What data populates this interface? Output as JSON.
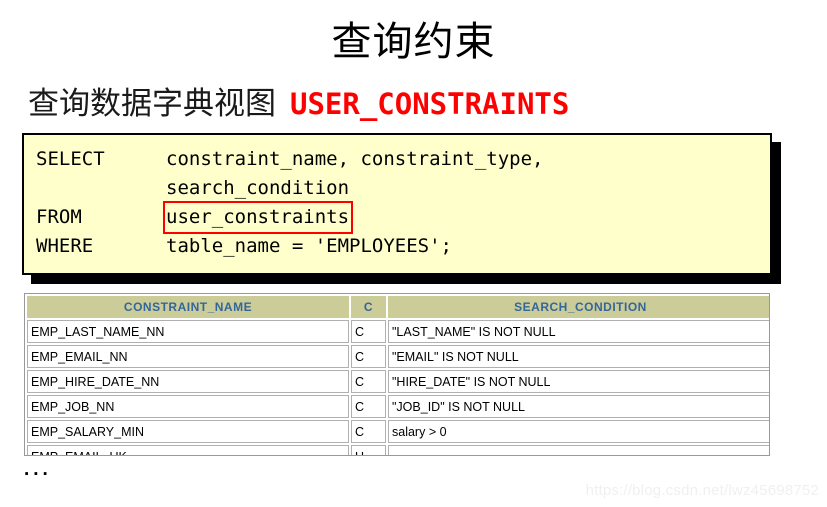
{
  "slide": {
    "title": "查询约束",
    "subtitle_cn": "查询数据字典视图",
    "subtitle_view": "USER_CONSTRAINTS",
    "ellipsis": "...",
    "watermark": "https://blog.csdn.net/lwz45698752"
  },
  "colors": {
    "code_background": "#FFFFCC",
    "code_border": "#000000",
    "highlight_box": "#FF0000",
    "accent_red": "#FF0000",
    "table_header_bg": "#CCCC99",
    "table_header_text": "#336699",
    "table_border": "#B0B0B0"
  },
  "sql": {
    "lines": [
      {
        "keyword": "SELECT",
        "value": "constraint_name, constraint_type,",
        "highlighted": false
      },
      {
        "keyword": "",
        "value": "search_condition",
        "highlighted": false
      },
      {
        "keyword": "FROM",
        "value": "user_constraints",
        "highlighted": true
      },
      {
        "keyword": "WHERE",
        "value": "table_name = 'EMPLOYEES';",
        "highlighted": false
      }
    ]
  },
  "result_table": {
    "columns": [
      "CONSTRAINT_NAME",
      "C",
      "SEARCH_CONDITION"
    ],
    "rows": [
      [
        "EMP_LAST_NAME_NN",
        "C",
        "\"LAST_NAME\" IS NOT NULL"
      ],
      [
        "EMP_EMAIL_NN",
        "C",
        "\"EMAIL\" IS NOT NULL"
      ],
      [
        "EMP_HIRE_DATE_NN",
        "C",
        "\"HIRE_DATE\" IS NOT NULL"
      ],
      [
        "EMP_JOB_NN",
        "C",
        "\"JOB_ID\" IS NOT NULL"
      ],
      [
        "EMP_SALARY_MIN",
        "C",
        "salary > 0"
      ],
      [
        "EMP_EMAIL_UK",
        "U",
        ""
      ],
      [
        "",
        "",
        ""
      ]
    ]
  }
}
